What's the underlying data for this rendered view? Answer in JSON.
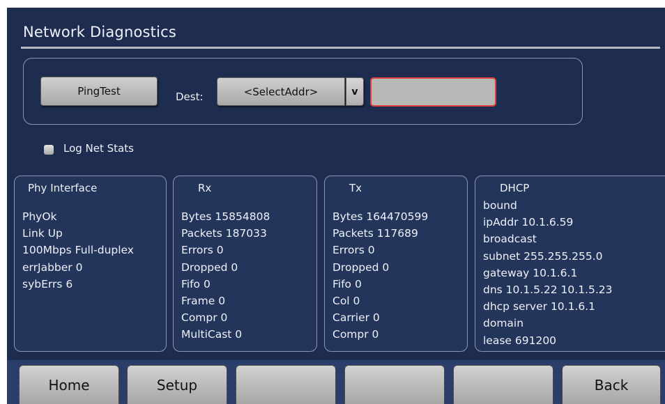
{
  "header": {
    "title": "Network Diagnostics"
  },
  "ping": {
    "button_label": "PingTest",
    "dest_label": "Dest:",
    "dest_value": "<SelectAddr>",
    "dest_arrow": "v",
    "result": ""
  },
  "log": {
    "label": "Log Net Stats",
    "checked": false
  },
  "panels": {
    "phy": {
      "title": "Phy Interface",
      "lines": [
        "PhyOk",
        "Link Up",
        "100Mbps Full-duplex",
        "errJabber 0",
        "sybErrs 6"
      ]
    },
    "rx": {
      "title": "Rx",
      "lines": [
        "Bytes 15854808",
        "Packets 187033",
        "Errors 0",
        "Dropped 0",
        "Fifo 0",
        "Frame 0",
        "Compr 0",
        "MultiCast 0"
      ]
    },
    "tx": {
      "title": "Tx",
      "lines": [
        "Bytes 164470599",
        "Packets 117689",
        "Errors 0",
        "Dropped 0",
        "Fifo 0",
        "Col 0",
        "Carrier 0",
        "Compr 0"
      ]
    },
    "dhcp": {
      "title": "DHCP",
      "lines": [
        "bound",
        "ipAddr 10.1.6.59",
        "broadcast",
        "subnet 255.255.255.0",
        "gateway 10.1.6.1",
        "dns 10.1.5.22 10.1.5.23",
        "dhcp server 10.1.6.1",
        "domain",
        "lease 691200"
      ]
    }
  },
  "nav": {
    "buttons": [
      "Home",
      "Setup",
      "",
      "",
      "",
      "Back"
    ]
  },
  "colors": {
    "background": "#1e2d4f",
    "panel_border": "#8a97b3",
    "result_border": "#e0403c"
  }
}
